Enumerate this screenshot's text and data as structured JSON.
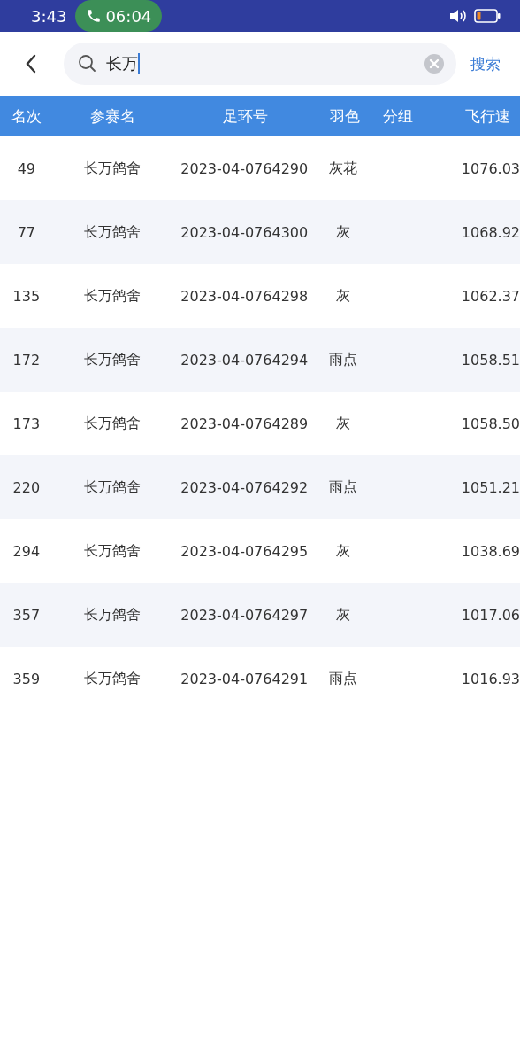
{
  "status_bar": {
    "time": "3:43",
    "call_timer": "06:04"
  },
  "search": {
    "value": "长万",
    "button": "搜索"
  },
  "table": {
    "columns": [
      "名次",
      "参赛名",
      "足环号",
      "羽色",
      "分组",
      "飞行速"
    ],
    "rows": [
      {
        "rank": "49",
        "name": "长万鸽舍",
        "ring": "2023-04-0764290",
        "plumage": "灰花",
        "speed": "1076.03"
      },
      {
        "rank": "77",
        "name": "长万鸽舍",
        "ring": "2023-04-0764300",
        "plumage": "灰",
        "speed": "1068.92"
      },
      {
        "rank": "135",
        "name": "长万鸽舍",
        "ring": "2023-04-0764298",
        "plumage": "灰",
        "speed": "1062.37"
      },
      {
        "rank": "172",
        "name": "长万鸽舍",
        "ring": "2023-04-0764294",
        "plumage": "雨点",
        "speed": "1058.51"
      },
      {
        "rank": "173",
        "name": "长万鸽舍",
        "ring": "2023-04-0764289",
        "plumage": "灰",
        "speed": "1058.50"
      },
      {
        "rank": "220",
        "name": "长万鸽舍",
        "ring": "2023-04-0764292",
        "plumage": "雨点",
        "speed": "1051.21"
      },
      {
        "rank": "294",
        "name": "长万鸽舍",
        "ring": "2023-04-0764295",
        "plumage": "灰",
        "speed": "1038.69"
      },
      {
        "rank": "357",
        "name": "长万鸽舍",
        "ring": "2023-04-0764297",
        "plumage": "灰",
        "speed": "1017.06"
      },
      {
        "rank": "359",
        "name": "长万鸽舍",
        "ring": "2023-04-0764291",
        "plumage": "雨点",
        "speed": "1016.93"
      }
    ]
  }
}
